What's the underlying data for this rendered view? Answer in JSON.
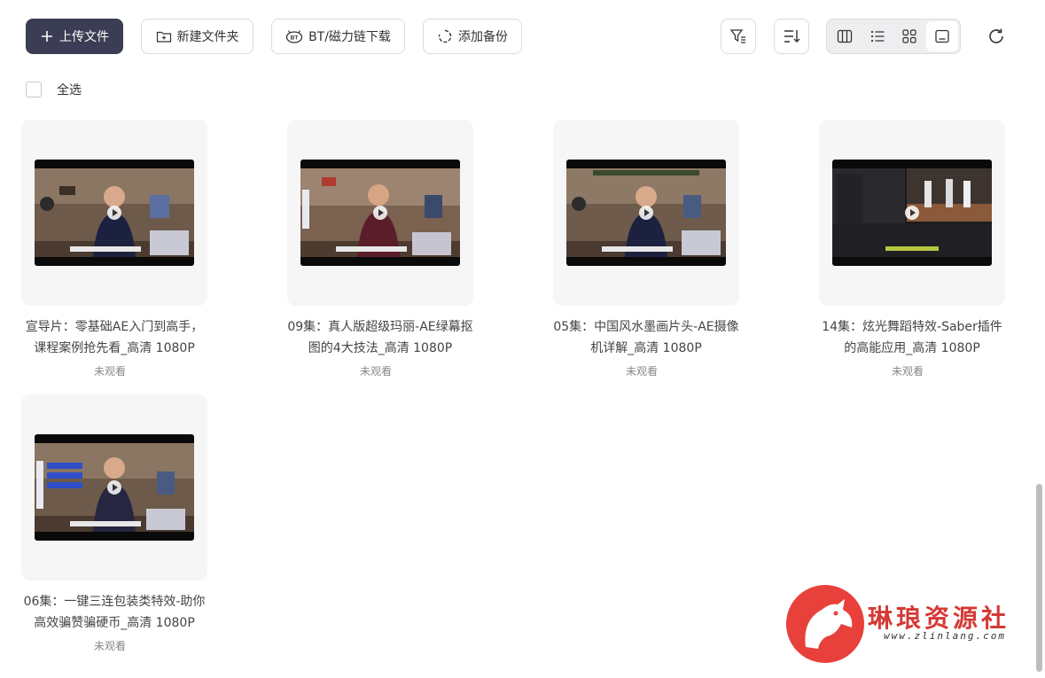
{
  "toolbar": {
    "upload_label": "上传文件",
    "new_folder_label": "新建文件夹",
    "bt_label": "BT/磁力链下载",
    "backup_label": "添加备份"
  },
  "select_all_label": "全选",
  "files": [
    {
      "title": "宣导片：零基础AE入门到高手，课程案例抢先看_高清 1080P",
      "status": "未观看"
    },
    {
      "title": "09集：真人版超级玛丽-AE绿幕抠图的4大技法_高清 1080P",
      "status": "未观看"
    },
    {
      "title": "05集：中国风水墨画片头-AE摄像机详解_高清 1080P",
      "status": "未观看"
    },
    {
      "title": "14集：炫光舞蹈特效-Saber插件的高能应用_高清 1080P",
      "status": "未观看"
    },
    {
      "title": "06集：一键三连包装类特效-助你高效骗赞骗硬币_高清 1080P",
      "status": "未观看"
    }
  ],
  "watermark": {
    "name": "琳琅资源社",
    "url": "www.zlinlang.com"
  },
  "colors": {
    "primary": "#3b3d54",
    "watermark": "#e8403a"
  }
}
